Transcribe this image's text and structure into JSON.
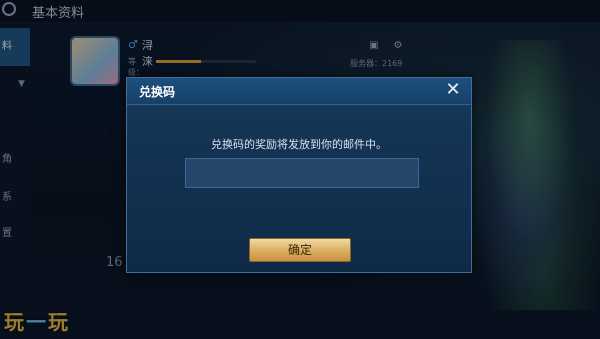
{
  "header": {
    "title": "基本资料"
  },
  "sidebar": {
    "items": [
      {
        "label": "料"
      },
      {
        "label": "角"
      },
      {
        "label": "系"
      },
      {
        "label": "置"
      }
    ]
  },
  "profile": {
    "name": "浔涞",
    "level_label": "等级：11",
    "exp_fraction": 0.45,
    "server_label": "服务器：2169"
  },
  "dialog": {
    "title": "兑换码",
    "message": "兑换码的奖励将发放到你的邮件中。",
    "input_value": "",
    "input_placeholder": "",
    "confirm_label": "确定"
  },
  "stats": {
    "value": "16"
  },
  "watermark": {
    "part1": "玩",
    "part2": "一",
    "part3": "玩"
  },
  "colors": {
    "accent_gold": "#d9ad5e",
    "dialog_bg": "#163858",
    "header_blue": "#1e4f7d"
  }
}
